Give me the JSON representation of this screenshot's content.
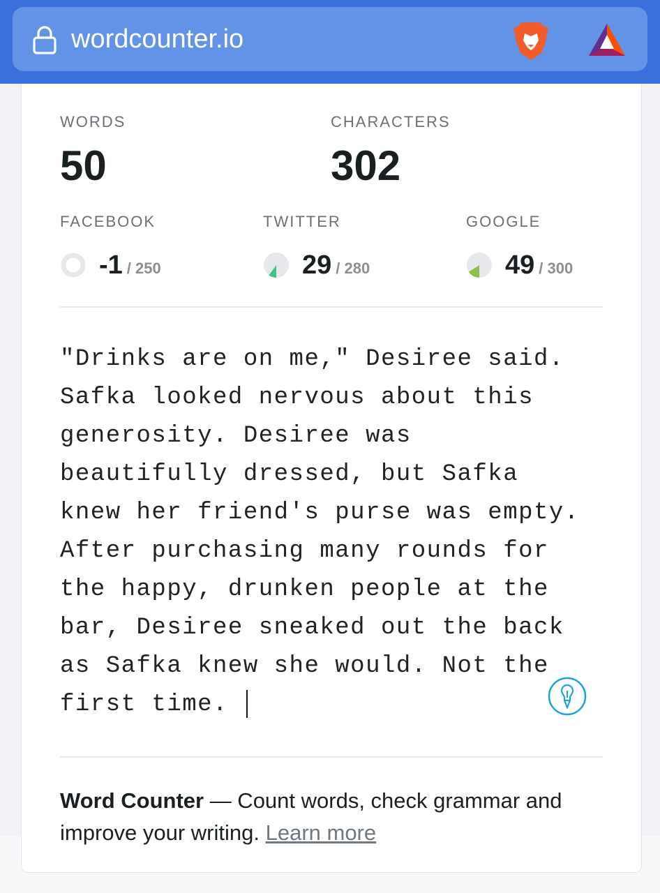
{
  "browser": {
    "url": "wordcounter.io",
    "brave_icon": "brave-lion-icon",
    "rewards_icon": "bat-rewards-icon",
    "lock_icon": "lock-icon"
  },
  "stats": {
    "words_label": "WORDS",
    "words_value": "50",
    "characters_label": "CHARACTERS",
    "characters_value": "302"
  },
  "limits": {
    "facebook": {
      "label": "FACEBOOK",
      "value": "-1",
      "max": "/ 250",
      "progress": 0.0
    },
    "twitter": {
      "label": "TWITTER",
      "value": "29",
      "max": "/ 280",
      "progress": 0.1,
      "color": "#3fc28a"
    },
    "google": {
      "label": "GOOGLE",
      "value": "49",
      "max": "/ 300",
      "progress": 0.16,
      "color": "#8bc34a"
    }
  },
  "editor": {
    "text": "\"Drinks are on me,\" Desiree said.\nSafka looked nervous about this\ngenerosity. Desiree was\nbeautifully dressed, but Safka\nknew her friend's purse was empty.\nAfter purchasing many rounds for\nthe happy, drunken people at the\nbar, Desiree sneaked out the back\nas Safka knew she would. Not the\nfirst time. ",
    "assistant_icon": "writing-assistant-icon"
  },
  "footer": {
    "brand": "Word Counter",
    "description": " — Count words, check grammar and improve your writing. ",
    "link": "Learn more"
  }
}
